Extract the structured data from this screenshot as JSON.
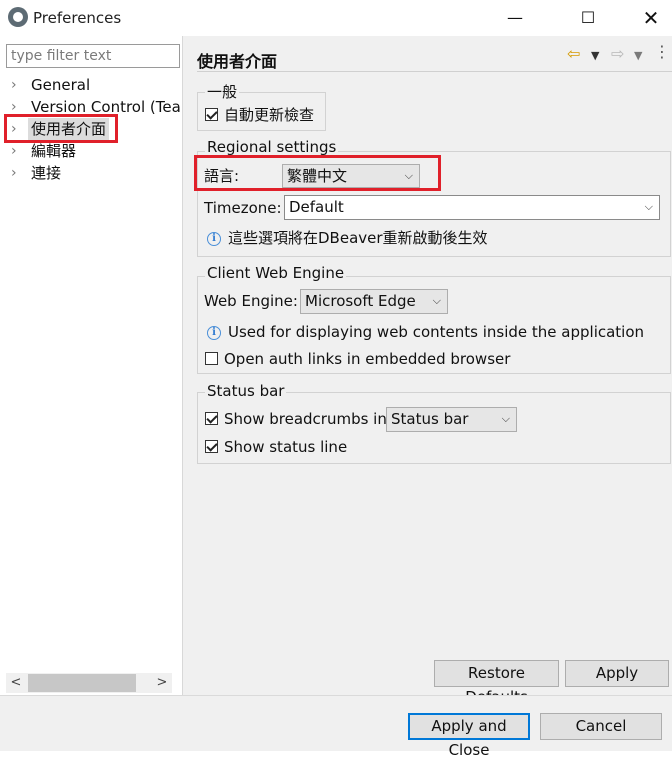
{
  "window": {
    "title": "Preferences",
    "controls": {
      "minimize": "—",
      "maximize": "☐",
      "close": "✕"
    }
  },
  "sidebar": {
    "filter_placeholder": "type filter text",
    "items": [
      {
        "label": "General"
      },
      {
        "label": "Version Control (Team)"
      },
      {
        "label": "使用者介面",
        "selected": true
      },
      {
        "label": "編輯器"
      },
      {
        "label": "連接"
      }
    ],
    "scroll_left": "<",
    "scroll_right": ">"
  },
  "page": {
    "title": "使用者介面",
    "nav": {
      "back": "⇦",
      "forward": "⇨",
      "dropdown": "▼",
      "menu": "⋮"
    }
  },
  "general_group": {
    "label": "一般",
    "auto_update_label": "自動更新檢查",
    "auto_update_checked": true
  },
  "regional": {
    "label": "Regional settings",
    "language_label": "語言:",
    "language_value": "繁體中文",
    "timezone_label": "Timezone:",
    "timezone_value": "Default",
    "info_text": "這些選項將在DBeaver重新啟動後生效"
  },
  "web_engine": {
    "label": "Client Web Engine",
    "engine_label": "Web Engine:",
    "engine_value": "Microsoft Edge",
    "info_text": "Used for displaying web contents inside the application",
    "auth_links_label": "Open auth links in embedded browser",
    "auth_links_checked": false
  },
  "status_bar": {
    "label": "Status bar",
    "breadcrumbs_label": "Show breadcrumbs in",
    "breadcrumbs_value": "Status bar",
    "breadcrumbs_checked": true,
    "status_line_label": "Show status line",
    "status_line_checked": true
  },
  "buttons": {
    "restore_defaults": "Restore Defaults",
    "apply": "Apply",
    "apply_and_close": "Apply and Close",
    "cancel": "Cancel"
  },
  "icons": {
    "info": "i",
    "chevron_right": "›",
    "chevron_down": "⌵"
  },
  "colors": {
    "highlight": "#e0202a",
    "panel_bg": "#f0f0f0",
    "default_button_border": "#0078d7"
  }
}
